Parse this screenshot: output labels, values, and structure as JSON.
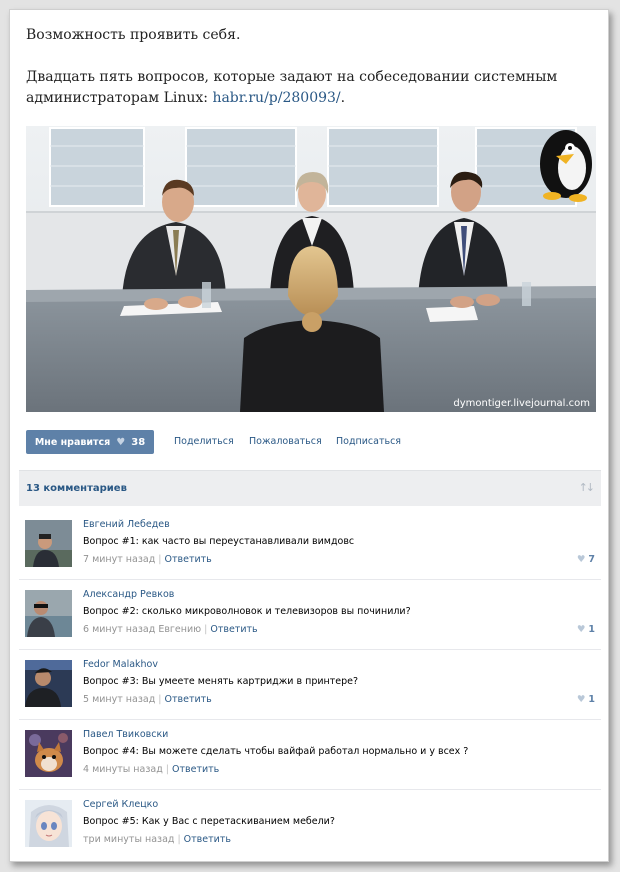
{
  "post": {
    "line1": "Возможность проявить себя.",
    "line2_text": "Двадцать пять вопросов, которые задают на собеседовании системным администраторам Linux: ",
    "link": "habr.ru/p/280093/",
    "line2_tail": ".",
    "watermark": "dymontiger.livejournal.com"
  },
  "actions": {
    "like_label": "Мне нравится",
    "like_icon": "heart-icon",
    "like_count": "38",
    "share": "Поделиться",
    "report": "Пожаловаться",
    "subscribe": "Подписаться"
  },
  "comments_header": {
    "title": "13 комментариев",
    "sort_icon": "sort-arrows-icon"
  },
  "comments": [
    {
      "author": "Евгений Лебедев",
      "text": "Вопрос #1: как часто вы переустанавливали вимдовс",
      "time": "7 минут назад",
      "reply_to": "",
      "reply": "Ответить",
      "likes": "7"
    },
    {
      "author": "Александр Ревков",
      "text": "Вопрос #2: сколько микроволновок и телевизоров вы починили?",
      "time": "6 минут назад",
      "reply_to": "Евгению",
      "reply": "Ответить",
      "likes": "1"
    },
    {
      "author": "Fedor Malakhov",
      "text": "Вопрос #3: Вы умеете менять картриджи в принтере?",
      "time": "5 минут назад",
      "reply_to": "",
      "reply": "Ответить",
      "likes": "1"
    },
    {
      "author": "Павел Твиковски",
      "text": "Вопрос #4: Вы можете сделать чтобы вайфай работал нормально и у всех ?",
      "time": "4 минуты назад",
      "reply_to": "",
      "reply": "Ответить",
      "likes": ""
    },
    {
      "author": "Сергей Клецко",
      "text": "Вопрос #5: Как у Вас с перетаскиванием мебели?",
      "time": "три минуты назад",
      "reply_to": "",
      "reply": "Ответить",
      "likes": ""
    }
  ],
  "colors": {
    "link": "#2a5885",
    "like_button": "#5e81a8",
    "header_bg": "#edeef0"
  }
}
